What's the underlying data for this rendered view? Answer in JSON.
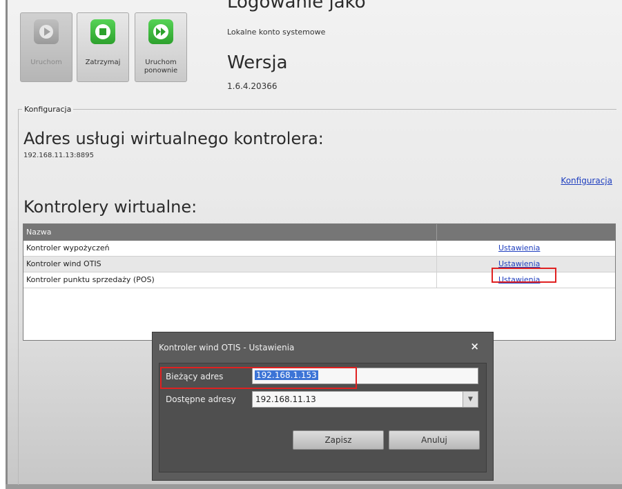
{
  "toolbar": {
    "start_label": "Uruchom",
    "stop_label": "Zatrzymaj",
    "restart_label": "Uruchom ponownie",
    "start_icon": "play-icon",
    "stop_icon": "stop-icon",
    "restart_icon": "fast-forward-icon"
  },
  "header": {
    "login_title": "Logowanie jako",
    "login_value": "Lokalne konto systemowe",
    "version_title": "Wersja",
    "version_value": "1.6.4.20366"
  },
  "config": {
    "legend": "Konfiguracja",
    "address_title": "Adres usługi wirtualnego kontrolera:",
    "address_value": "192.168.11.13:8895",
    "config_link": "Konfiguracja",
    "controllers_title": "Kontrolery wirtualne:"
  },
  "table": {
    "header_name": "Nazwa",
    "rows": [
      {
        "name": "Kontroler wypożyczeń",
        "link": "Ustawienia"
      },
      {
        "name": "Kontroler wind OTIS",
        "link": "Ustawienia"
      },
      {
        "name": "Kontroler punktu sprzedaży (POS)",
        "link": "Ustawienia"
      }
    ]
  },
  "dialog": {
    "title": "Kontroler wind OTIS - Ustawienia",
    "close": "×",
    "current_label": "Bieżący adres",
    "current_value": "192.168.1.153",
    "available_label": "Dostępne adresy",
    "available_value": "192.168.11.13",
    "save_label": "Zapisz",
    "cancel_label": "Anuluj"
  },
  "colors": {
    "highlight": "#e02020",
    "link": "#1f3fbf",
    "selection": "#3c74d6"
  }
}
